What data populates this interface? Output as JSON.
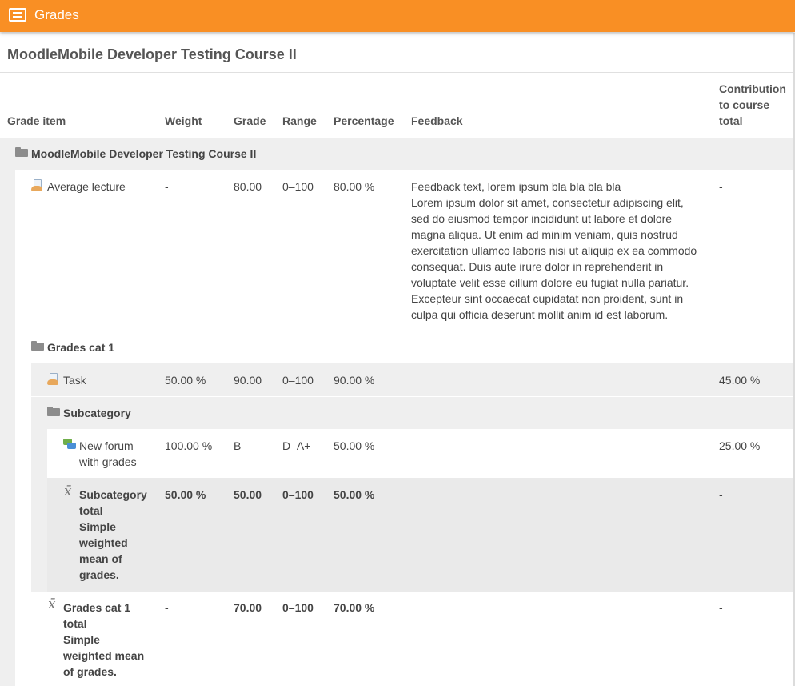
{
  "app": {
    "title": "Grades"
  },
  "course": {
    "title": "MoodleMobile Developer Testing Course II"
  },
  "columns": {
    "item": "Grade item",
    "weight": "Weight",
    "grade": "Grade",
    "range": "Range",
    "percentage": "Percentage",
    "feedback": "Feedback",
    "contribution_1": "Contribution",
    "contribution_2": "to course",
    "contribution_3": "total"
  },
  "rows": {
    "course_category": {
      "name": "MoodleMobile Developer Testing Course II"
    },
    "average_lecture": {
      "name": "Average lecture",
      "weight": "-",
      "grade": "80.00",
      "range": "0–100",
      "percentage": "80.00 %",
      "feedback": [
        "Feedback text, lorem ipsum bla bla bla bla",
        "Lorem ipsum dolor sit amet, consectetur adipiscing elit,",
        "sed do eiusmod tempor incididunt ut labore et dolore",
        "magna aliqua. Ut enim ad minim veniam, quis nostrud",
        "exercitation ullamco laboris nisi ut aliquip ex ea commodo",
        "consequat. Duis aute irure dolor in reprehenderit in",
        "voluptate velit esse cillum dolore eu fugiat nulla pariatur.",
        "Excepteur sint occaecat cupidatat non proident, sunt in",
        "culpa qui officia deserunt mollit anim id est laborum."
      ],
      "contribution": "-"
    },
    "grades_cat_1": {
      "name": "Grades cat 1"
    },
    "task": {
      "name": "Task",
      "weight": "50.00 %",
      "grade": "90.00",
      "range": "0–100",
      "percentage": "90.00 %",
      "contribution": "45.00 %"
    },
    "subcategory": {
      "name": "Subcategory"
    },
    "new_forum": {
      "name_1": "New forum",
      "name_2": "with grades",
      "weight": "100.00 %",
      "grade": "B",
      "range": "D–A+",
      "percentage": "50.00 %",
      "contribution": "25.00 %"
    },
    "subcategory_total": {
      "name_1": "Subcategory",
      "name_2": "total",
      "name_3": "Simple",
      "name_4": "weighted",
      "name_5": "mean of",
      "name_6": "grades.",
      "weight": "50.00 %",
      "grade": "50.00",
      "range": "0–100",
      "percentage": "50.00 %",
      "contribution": "-"
    },
    "grades_cat_1_total": {
      "name_1": "Grades cat 1",
      "name_2": "total",
      "name_3": "Simple",
      "name_4": "weighted mean",
      "name_5": "of grades.",
      "weight": "-",
      "grade": "70.00",
      "range": "0–100",
      "percentage": "70.00 %",
      "contribution": "-"
    },
    "mean_symbol": "x̄"
  },
  "colors": {
    "brand": "#f98f24",
    "band_level_1": "#efefef",
    "band_level_2": "#f4f4f4",
    "band_level_3": "#eaeaea"
  },
  "icons": [
    "menu-icon",
    "folder-icon",
    "assignment-icon",
    "forum-icon",
    "mean-icon"
  ]
}
